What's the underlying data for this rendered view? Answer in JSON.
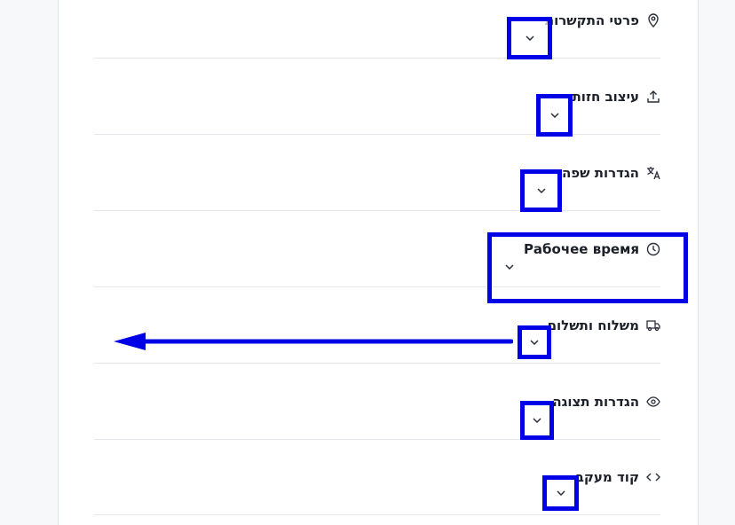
{
  "sections": [
    {
      "label": "פרטי התקשרות",
      "icon": "location-pin-icon"
    },
    {
      "label": "עיצוב חזות",
      "icon": "upload-icon"
    },
    {
      "label": "הגדרות שפה",
      "icon": "translate-icon"
    },
    {
      "label": "Рабочее время",
      "icon": "clock-icon"
    },
    {
      "label": "משלוח ותשלום",
      "icon": "truck-icon"
    },
    {
      "label": "הגדרות תצוגה",
      "icon": "eye-icon"
    },
    {
      "label": "קוד מעקב",
      "icon": "code-icon"
    }
  ],
  "annotation_color": "#0000e6"
}
